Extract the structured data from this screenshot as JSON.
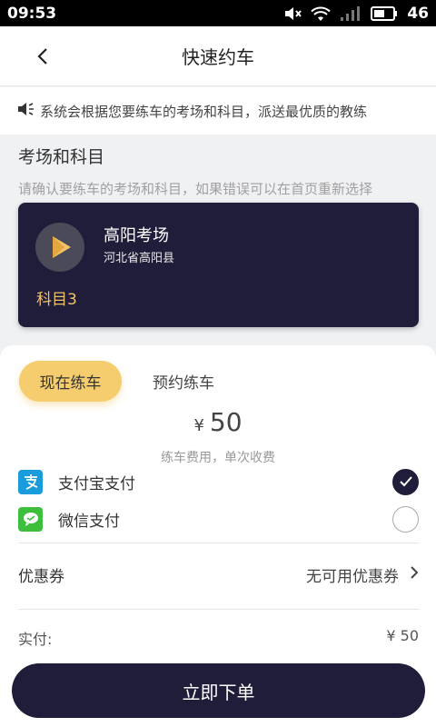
{
  "status_bar": {
    "time": "09:53",
    "battery": "46"
  },
  "nav": {
    "title": "快速约车"
  },
  "notice": {
    "text": "系统会根据您要练车的考场和科目，派送最优质的教练"
  },
  "section": {
    "title": "考场和科目",
    "subtitle": "请确认要练车的考场和科目，如果错误可以在首页重新选择"
  },
  "venue": {
    "name": "高阳考场",
    "address": "河北省高阳县",
    "subject": "科目3"
  },
  "tabs": {
    "now": "现在练车",
    "later": "预约练车"
  },
  "price": {
    "currency": "¥",
    "amount": "50",
    "note": "练车费用，单次收费"
  },
  "payment": [
    {
      "label": "支付宝支付",
      "selected": true,
      "icon": "alipay-icon",
      "color": "#1a9bdc"
    },
    {
      "label": "微信支付",
      "selected": false,
      "icon": "wechat-icon",
      "color": "#3dbf3d"
    }
  ],
  "coupon": {
    "label": "优惠券",
    "value": "无可用优惠券"
  },
  "paid": {
    "label": "实付:",
    "value": "¥ 50"
  },
  "order_button": {
    "label": "立即下单"
  },
  "colors": {
    "primary": "#201d3a",
    "accent": "#f5cd6f",
    "subject": "#f2c36a"
  }
}
